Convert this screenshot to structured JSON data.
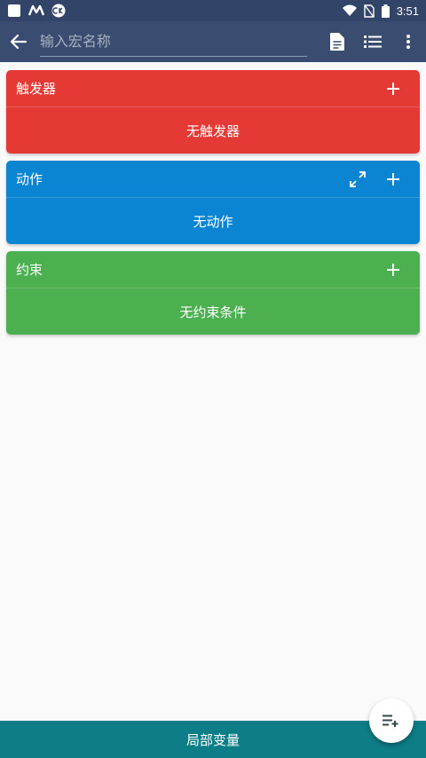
{
  "status_bar": {
    "time": "3:51",
    "icons": [
      "square-notification-icon",
      "m-app-icon",
      "ck-app-icon",
      "wifi-icon",
      "no-sim-icon",
      "battery-icon"
    ]
  },
  "app_bar": {
    "name_placeholder": "输入宏名称",
    "actions": [
      "description-icon",
      "list-icon",
      "more-vert-icon"
    ]
  },
  "cards": {
    "triggers": {
      "title": "触发器",
      "empty": "无触发器",
      "color": "#e53935"
    },
    "actions": {
      "title": "动作",
      "empty": "无动作",
      "color": "#0b84d2"
    },
    "constraints": {
      "title": "约束",
      "empty": "无约束条件",
      "color": "#4caf50"
    }
  },
  "bottom_bar": {
    "label": "局部变量",
    "color": "#0d7e87"
  },
  "fab": {
    "icon": "add-to-list-icon"
  }
}
